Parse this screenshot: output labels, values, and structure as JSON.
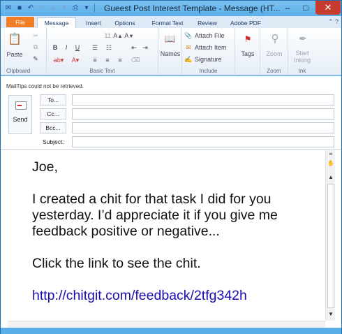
{
  "window": {
    "title": "Gueest Post Interest Template - Message (HT...",
    "minimize": "–",
    "maximize": "□",
    "close": "✕"
  },
  "tabs": [
    {
      "label": "File"
    },
    {
      "label": "Message"
    },
    {
      "label": "Insert"
    },
    {
      "label": "Options"
    },
    {
      "label": "Format Text"
    },
    {
      "label": "Review"
    },
    {
      "label": "Adobe PDF"
    }
  ],
  "ribbon": {
    "clipboard": {
      "label": "Clipboard",
      "paste": "Paste"
    },
    "basic_text": {
      "label": "Basic Text",
      "font_size": "11"
    },
    "names": {
      "label": "Names"
    },
    "include": {
      "label": "Include",
      "attach_file": "Attach File",
      "attach_item": "Attach Item",
      "signature": "Signature"
    },
    "tags": {
      "label": "Tags"
    },
    "zoom": {
      "label": "Zoom",
      "button": "Zoom"
    },
    "ink": {
      "label": "Ink",
      "start": "Start",
      "inking": "Inking"
    }
  },
  "header": {
    "mailtips": "MailTips could not be retrieved.",
    "send": "Send",
    "to": "To...",
    "cc": "Cc...",
    "bcc": "Bcc...",
    "subject_label": "Subject:"
  },
  "body": {
    "greeting": "Joe,",
    "para1": "I created a chit for that task I did for you yesterday.  I’d appreciate it if you give me feedback positive or negative...",
    "para2": "Click the link to see the chit.",
    "link": "http://chitgit.com/feedback/2tfg342h"
  }
}
